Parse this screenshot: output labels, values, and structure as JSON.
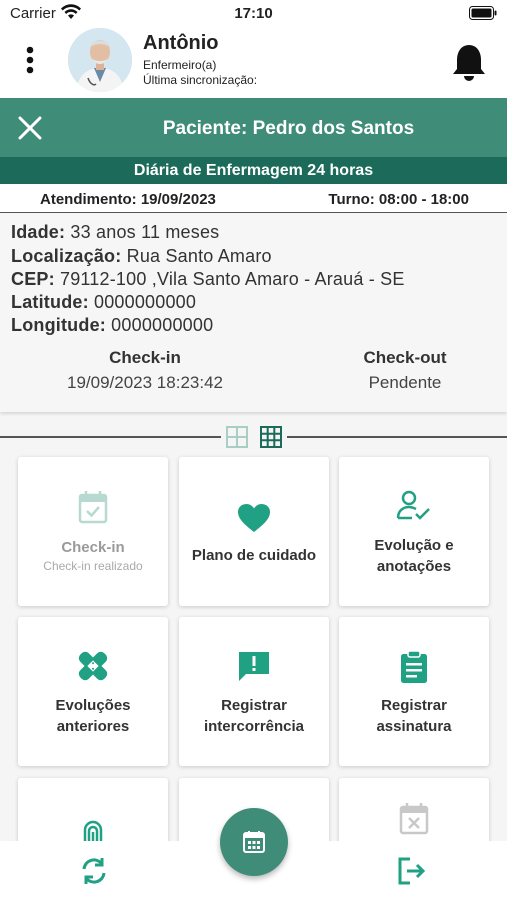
{
  "status_bar": {
    "carrier": "Carrier",
    "time": "17:10"
  },
  "user": {
    "name": "Antônio",
    "role": "Enfermeiro(a)",
    "sync_label": "Última sincronização:"
  },
  "patient": {
    "title": "Paciente: Pedro dos Santos"
  },
  "diaria": {
    "title": "Diária de Enfermagem 24 horas"
  },
  "shift": {
    "atendimento": "Atendimento: 19/09/2023",
    "turno": "Turno: 08:00 - 18:00"
  },
  "info": {
    "idade_label": "Idade:",
    "idade": " 33 anos 11 meses",
    "localizacao_label": "Localização:",
    "localizacao": " Rua Santo Amaro",
    "cep_label": "CEP:",
    "cep": " 79112-100 ,Vila Santo Amaro - Arauá - SE",
    "latitude_label": "Latitude:",
    "latitude": " 0000000000",
    "longitude_label": "Longitude:",
    "longitude": " 0000000000"
  },
  "checkin": {
    "label": "Check-in",
    "value": "19/09/2023 18:23:42"
  },
  "checkout": {
    "label": "Check-out",
    "value": "Pendente"
  },
  "tiles": [
    {
      "icon": "calendar-check-icon",
      "label": "Check-in",
      "sub": "Check-in realizado",
      "enabled": false
    },
    {
      "icon": "heart-icon",
      "label": "Plano de cuidado",
      "enabled": true
    },
    {
      "icon": "user-check-icon",
      "label_line1": "Evolução e",
      "label_line2": "anotações",
      "enabled": true
    },
    {
      "icon": "bandage-icon",
      "label_line1": "Evoluções",
      "label_line2": "anteriores",
      "enabled": true
    },
    {
      "icon": "message-alert-icon",
      "label_line1": "Registrar",
      "label_line2": "intercorrência",
      "enabled": true
    },
    {
      "icon": "clipboard-icon",
      "label_line1": "Registrar",
      "label_line2": "assinatura",
      "enabled": true
    },
    {
      "icon": "fingerprint-icon",
      "enabled": true
    },
    {
      "icon": "blank-icon",
      "enabled": true
    },
    {
      "icon": "calendar-x-icon",
      "enabled": false
    }
  ],
  "colors": {
    "primary": "#3f8c78",
    "primary_dark": "#1c6a59",
    "icon_accent": "#21a183"
  }
}
